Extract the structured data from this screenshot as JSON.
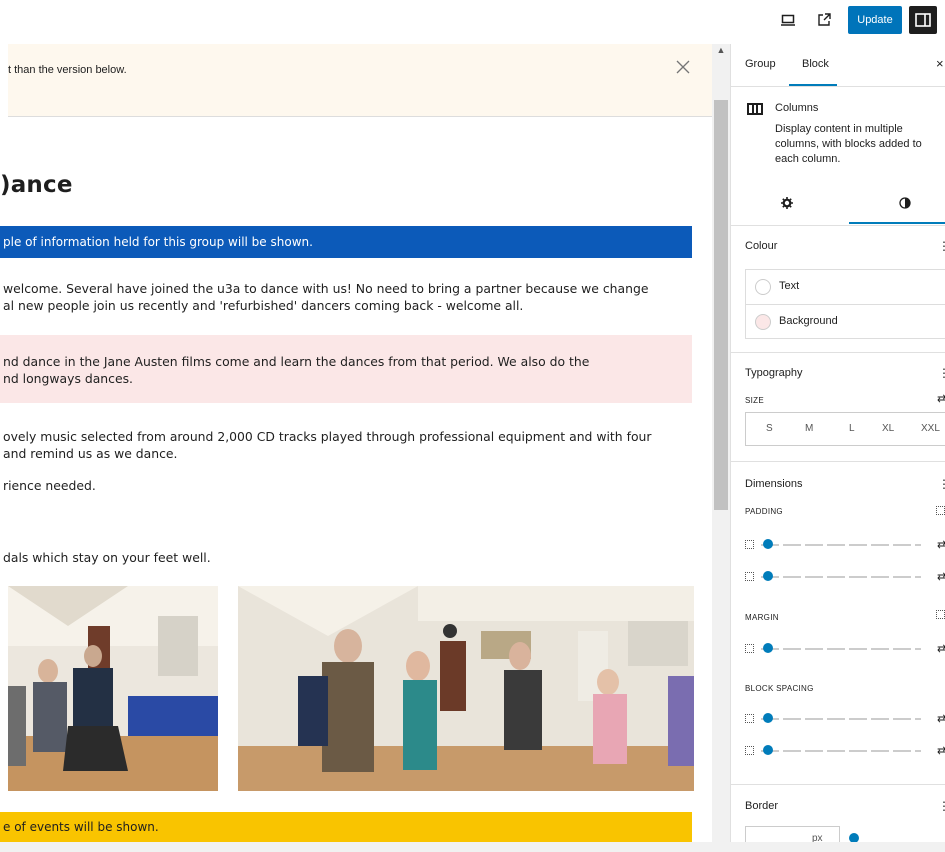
{
  "topbar": {
    "update_label": "Update"
  },
  "icons": {
    "desktop": "desktop-preview-icon",
    "external": "external-link-icon",
    "sidebar": "sidebar-toggle-icon"
  },
  "canvas": {
    "notice_text": "t than the version below.",
    "title": ")ance",
    "blue_bar": "ple of information held for this group will be shown.",
    "para1_line1": "welcome. Several have joined the u3a to dance with us! No need to bring a partner because we change",
    "para1_line2": "al new people join us recently and 'refurbished' dancers coming back - welcome all.",
    "pink_line1": "nd dance in the Jane Austen films come and learn the dances from that period. We also do the",
    "pink_line2": "nd longways dances.",
    "para2_line1": "ovely music selected from around 2,000 CD tracks played through professional equipment and with four",
    "para2_line2": "and remind us as we dance.",
    "para3": "rience needed.",
    "para4": "dals which stay on your feet well.",
    "yellow_bar": "e of events will be shown."
  },
  "sidebar": {
    "tabs": [
      "Group",
      "Block"
    ],
    "active_tab": "Block",
    "block_name": "Columns",
    "block_description": "Display content in multiple columns, with blocks added to each column.",
    "colour_title": "Colour",
    "colour_items": [
      "Text",
      "Background"
    ],
    "typography_title": "Typography",
    "size_label": "SIZE",
    "size_options": [
      "S",
      "M",
      "L",
      "XL",
      "XXL"
    ],
    "dimensions_title": "Dimensions",
    "padding_label": "PADDING",
    "margin_label": "MARGIN",
    "block_spacing_label": "BLOCK SPACING",
    "border_title": "Border",
    "border_unit": "px"
  },
  "colors": {
    "accent": "#007cba",
    "update_button": "#0074ba",
    "blue_bar": "#0c5ab9",
    "pink_bar": "#fbe7e7",
    "yellow_bar": "#f9c400",
    "notice_bg": "#fef8ee"
  }
}
